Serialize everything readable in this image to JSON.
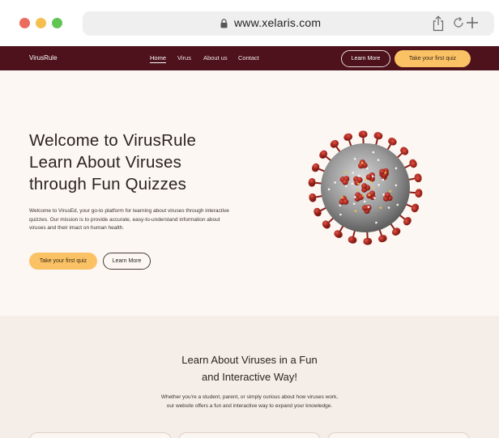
{
  "browser": {
    "url": "www.xelaris.com"
  },
  "nav": {
    "brand": "VirusRule",
    "links": [
      "Home",
      "Virus",
      "About us",
      "Contact"
    ],
    "learn_more": "Learn More",
    "take_quiz": "Take your first quiz"
  },
  "hero": {
    "title_lines": [
      "Welcome to VirusRule",
      "Learn About Viruses",
      "through Fun Quizzes"
    ],
    "description": "Welcome to VirusEd, your go-to platform for learning about viruses through interactive quizzes. Our mission is to provide accurate, easy-to-understand information about viruses and their imact on human health.",
    "take_quiz": "Take your first quiz",
    "learn_more": "Learn More"
  },
  "section2": {
    "title_lines": [
      "Learn About Viruses in a Fun",
      "and Interactive Way!"
    ],
    "description_lines": [
      "Whether you're a student, parent, or simply curious about how viruses work,",
      "our website offers a fun and interactive way to expand your knowledge."
    ]
  },
  "colors": {
    "nav_bg": "#4d121b",
    "accent": "#fbc265",
    "hero_bg": "#fdf7f3",
    "section_bg": "#f4ede8"
  }
}
